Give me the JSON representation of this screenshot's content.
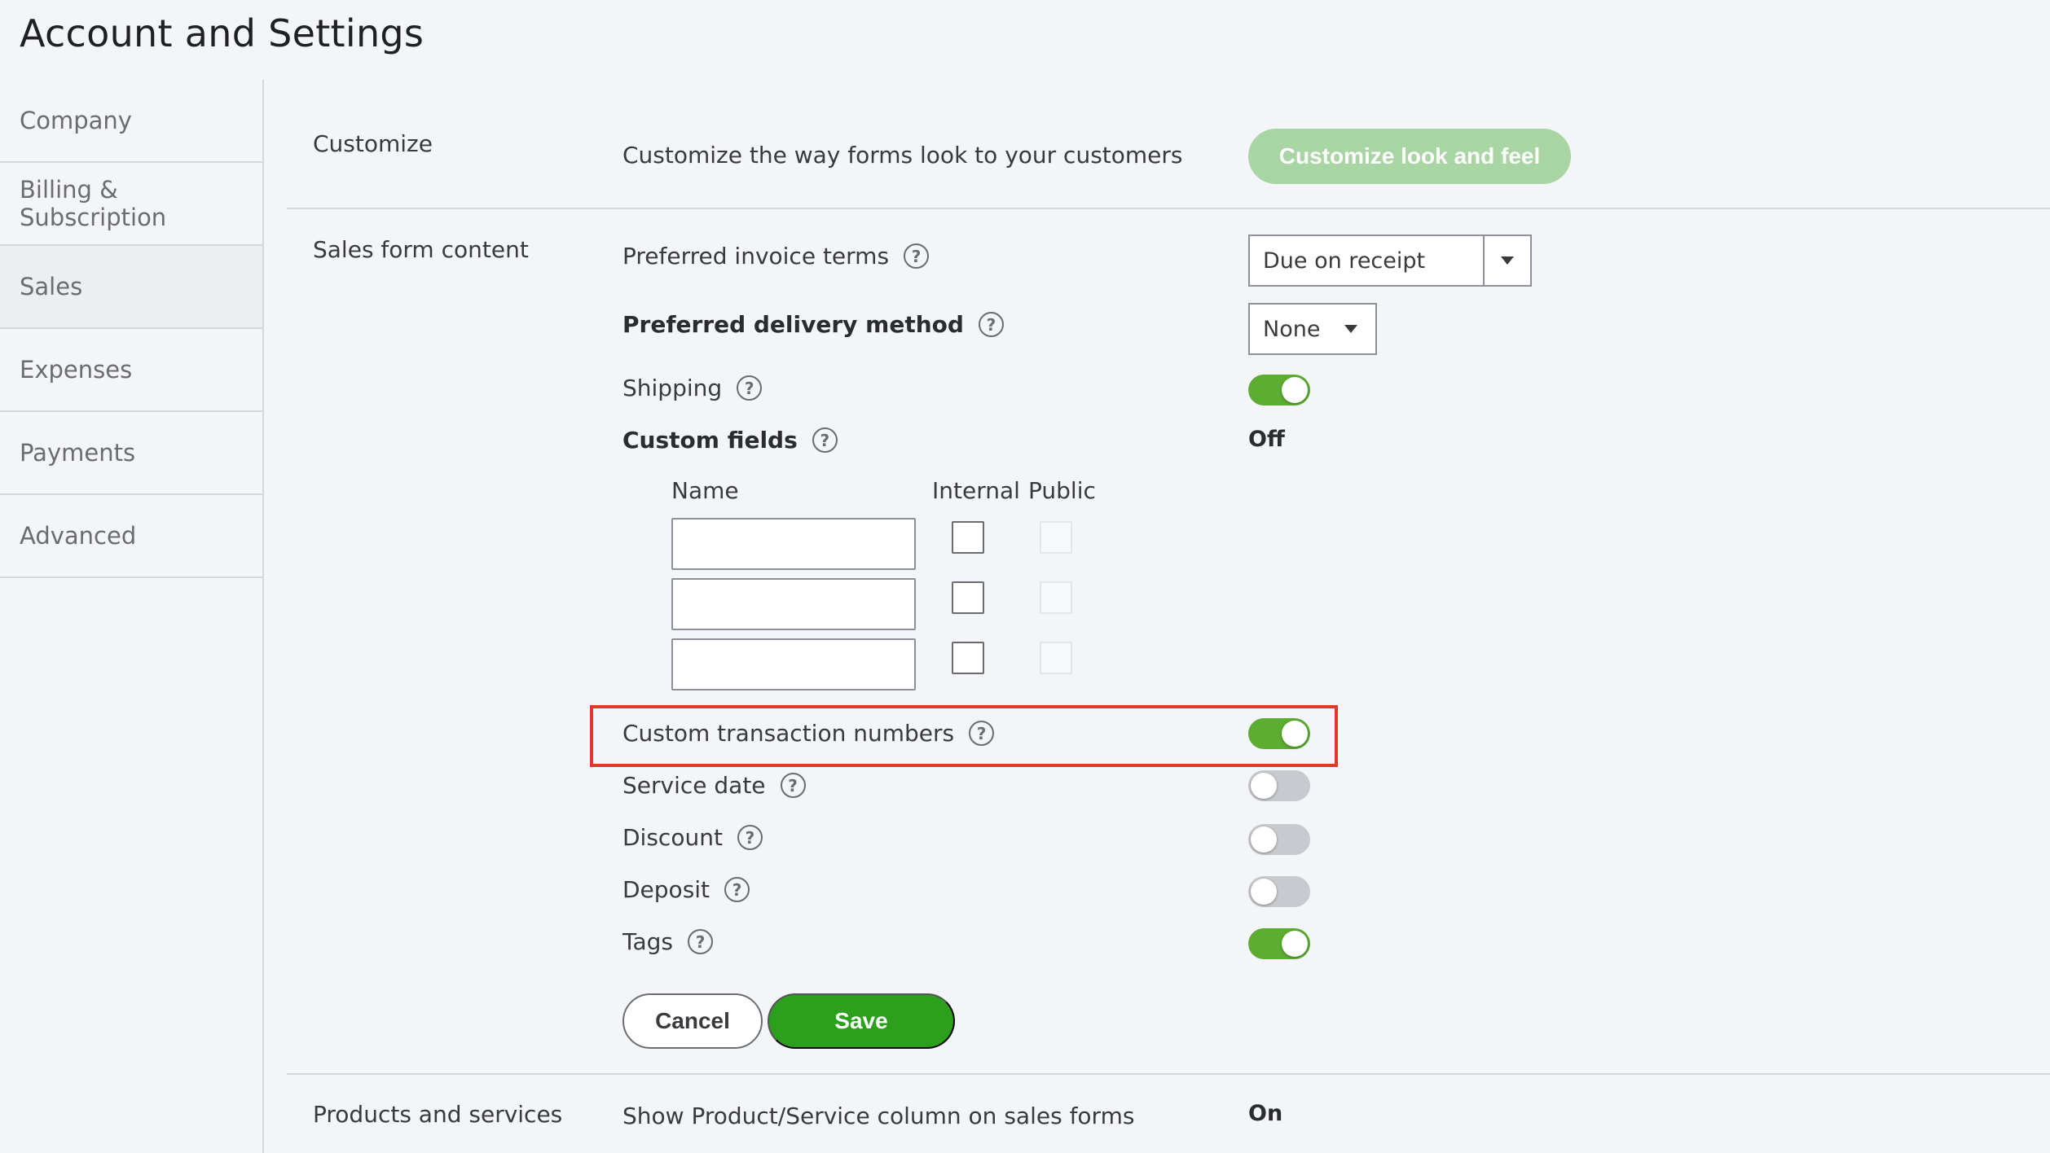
{
  "page": {
    "title": "Account and Settings"
  },
  "sidebar": {
    "items": [
      {
        "label": "Company"
      },
      {
        "label": "Billing & Subscription"
      },
      {
        "label": "Sales"
      },
      {
        "label": "Expenses"
      },
      {
        "label": "Payments"
      },
      {
        "label": "Advanced"
      }
    ],
    "active": "Sales"
  },
  "customize": {
    "section_label": "Customize",
    "description": "Customize the way forms look to your customers",
    "button_label": "Customize look and feel"
  },
  "sales_form": {
    "section_label": "Sales form content",
    "invoice_terms": {
      "label": "Preferred invoice terms",
      "value": "Due on receipt"
    },
    "delivery_method": {
      "label": "Preferred delivery method",
      "value": "None"
    },
    "shipping": {
      "label": "Shipping",
      "enabled": true
    },
    "custom_fields": {
      "label": "Custom fields",
      "status": "Off",
      "columns": {
        "name": "Name",
        "internal": "Internal",
        "public": "Public"
      },
      "rows": [
        {
          "name": "",
          "internal": false,
          "public": false
        },
        {
          "name": "",
          "internal": false,
          "public": false
        },
        {
          "name": "",
          "internal": false,
          "public": false
        }
      ]
    },
    "custom_transaction_numbers": {
      "label": "Custom transaction numbers",
      "enabled": true
    },
    "service_date": {
      "label": "Service date",
      "enabled": false
    },
    "discount": {
      "label": "Discount",
      "enabled": false
    },
    "deposit": {
      "label": "Deposit",
      "enabled": false
    },
    "tags": {
      "label": "Tags",
      "enabled": true
    },
    "cancel_label": "Cancel",
    "save_label": "Save"
  },
  "products": {
    "section_label": "Products and services",
    "description": "Show Product/Service column on sales forms",
    "status": "On"
  },
  "colors": {
    "toggle_on": "#5cad32",
    "save_green": "#2ca01c",
    "highlight_red": "#e0372c"
  }
}
